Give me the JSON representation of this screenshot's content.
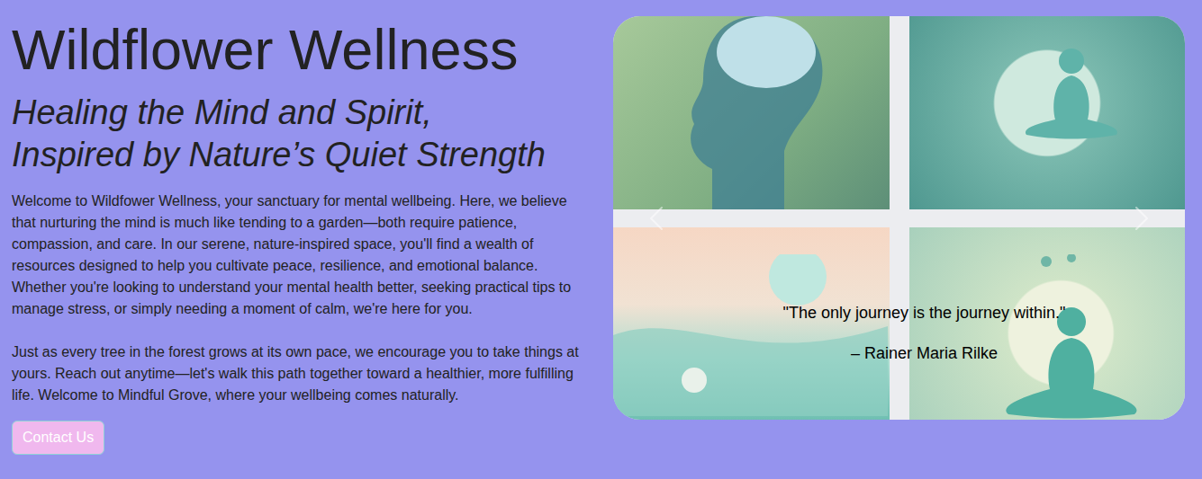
{
  "brand": {
    "title": "Wildflower Wellness",
    "subtitle_lines": [
      "Healing the Mind and Spirit,",
      "Inspired by Nature’s Quiet Strength"
    ]
  },
  "paragraphs": [
    "Welcome to Wildfower Wellness, your sanctuary for mental wellbeing. Here, we believe that nurturing the mind is much like tending to a garden—both require patience, compassion, and care. In our serene, nature-inspired space, you'll find a wealth of resources designed to help you cultivate peace, resilience, and emotional balance. Whether you're looking to understand your mental health better, seeking practical tips to manage stress, or simply needing a moment of calm, we're here for you.",
    "Just as every tree in the forest grows at its own pace, we encourage you to take things at yours. Reach out anytime—let's walk this path together toward a healthier, more fulfilling life. Welcome to Mindful Grove, where your wellbeing comes naturally."
  ],
  "contact_button": "Contact Us",
  "carousel": {
    "quote": "\"The only journey is the journey within.\"",
    "author": "– Rainer Maria Rilke"
  }
}
